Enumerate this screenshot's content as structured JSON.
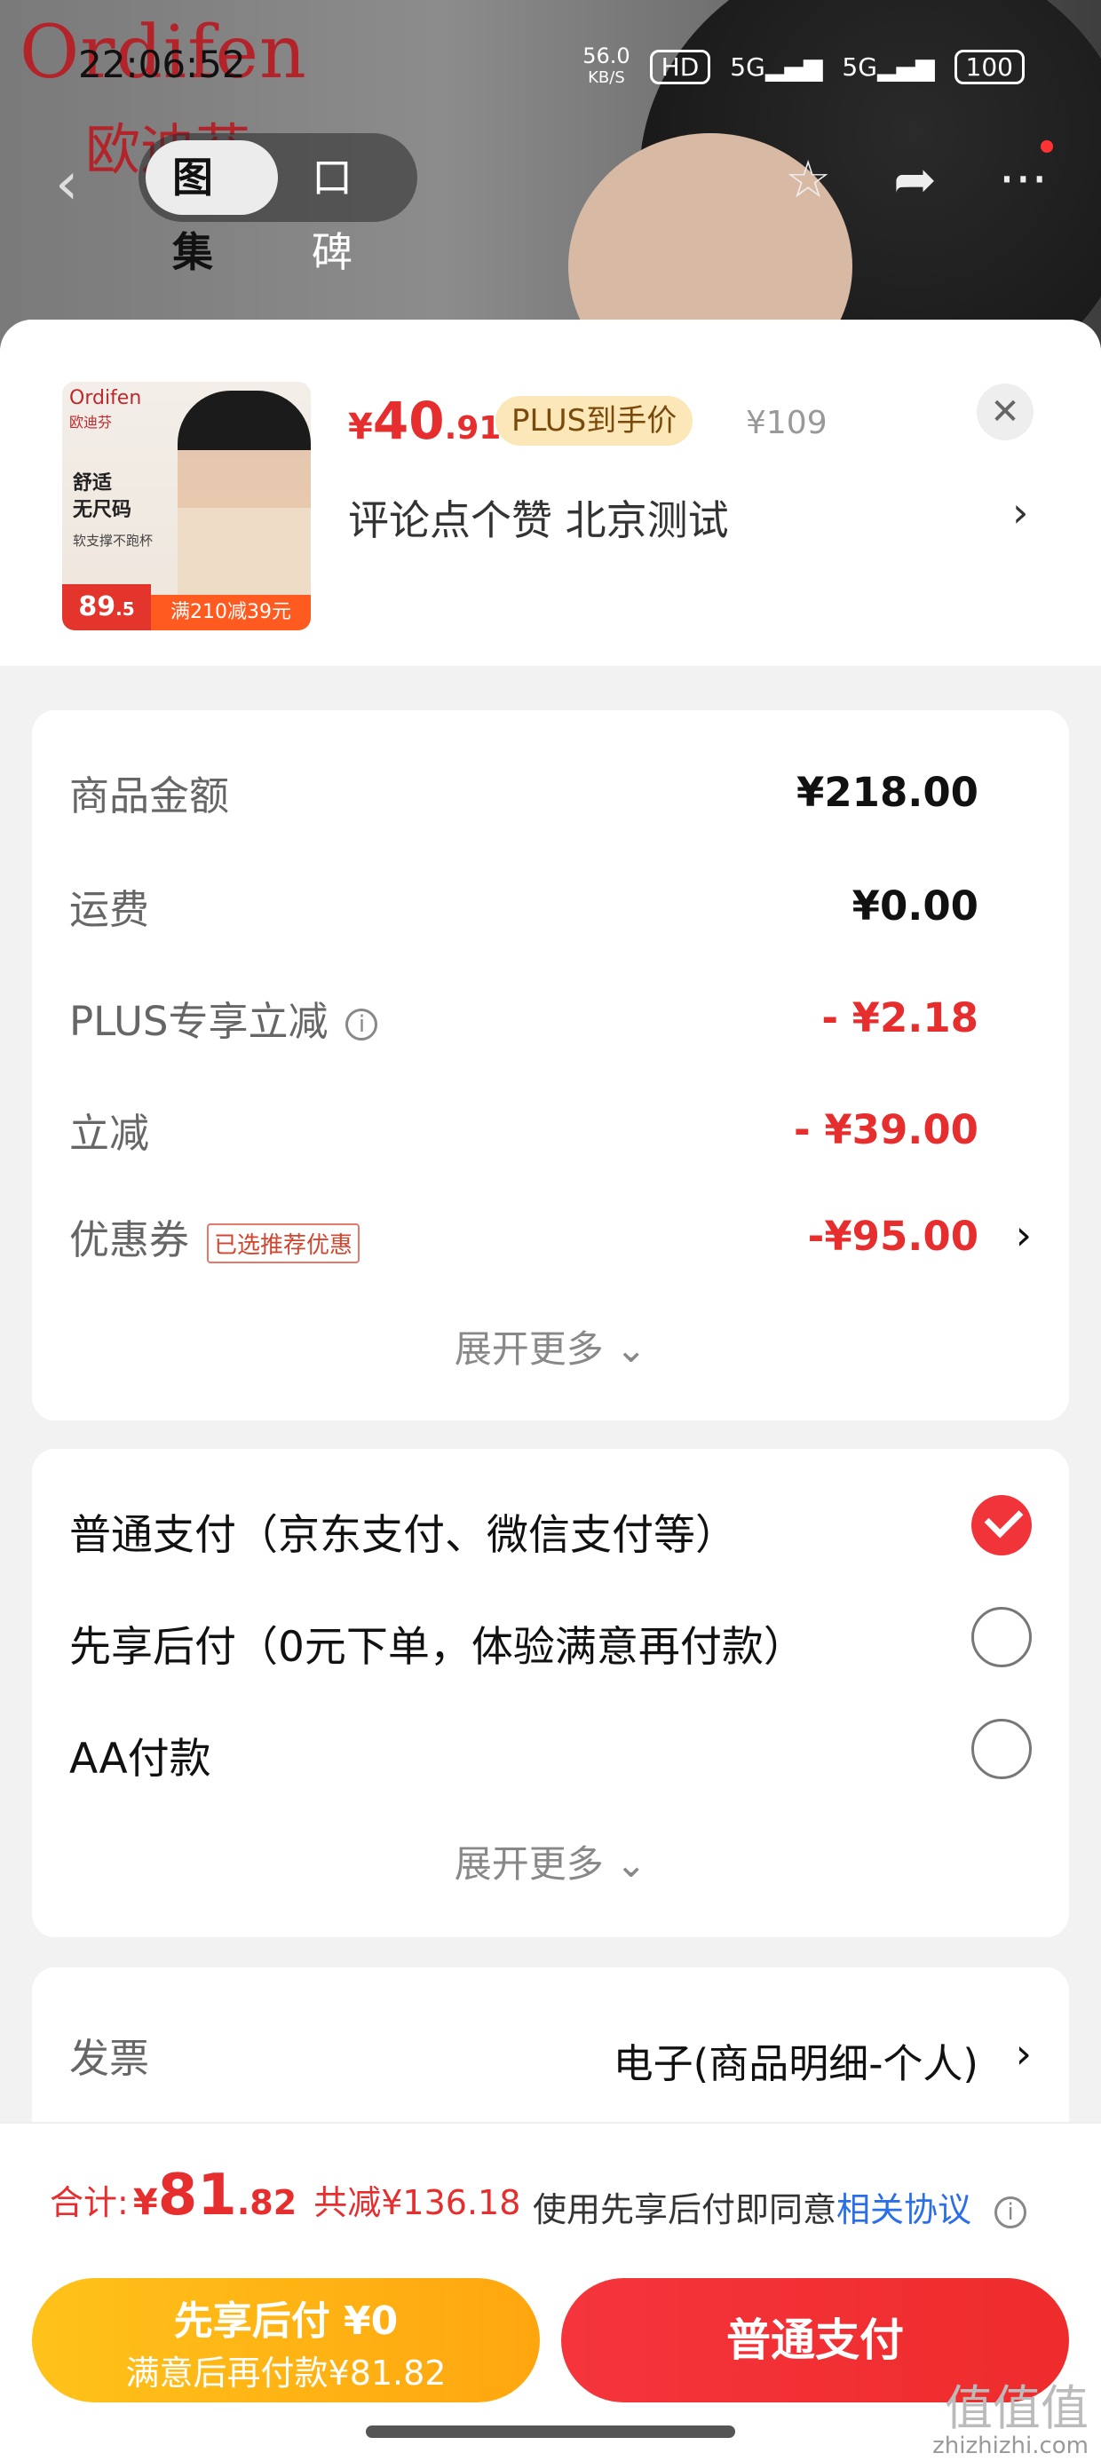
{
  "status_bar": {
    "time": "22:06:52",
    "speed": "56.0",
    "speed_unit": "KB/S",
    "hd": "HD",
    "net1": "5G",
    "net2": "5G",
    "battery": "100"
  },
  "hero": {
    "brand_en": "Ordifen",
    "brand_cn": "欧迪芬"
  },
  "nav": {
    "tabs": [
      {
        "label": "图集",
        "active": true
      },
      {
        "label": "口碑",
        "active": false
      }
    ]
  },
  "product": {
    "thumb": {
      "brand_en": "Ordifen",
      "brand_cn": "欧迪芬",
      "line1": "舒适",
      "line2": "无尺码",
      "line3": "软支撑不跑杯",
      "price": "89",
      "price_dec": ".5",
      "promo": "满210减39元"
    },
    "price_currency": "¥",
    "price_int": "40",
    "price_dec": ".91",
    "plus_badge": "PLUS到手价",
    "original_price": "¥109",
    "address": "评论点个赞  北京测试"
  },
  "amounts": {
    "rows": [
      {
        "label": "商品金额",
        "value": "¥218.00",
        "red": false
      },
      {
        "label": "运费",
        "value": "¥0.00",
        "red": false
      },
      {
        "label": "PLUS专享立减",
        "value": "- ¥2.18",
        "red": true
      },
      {
        "label": "立减",
        "value": "- ¥39.00",
        "red": true
      },
      {
        "label": "优惠券",
        "tag": "已选推荐优惠",
        "value": "-¥95.00",
        "red": true
      }
    ],
    "more": "展开更多"
  },
  "payment": {
    "options": [
      {
        "label": "普通支付（京东支付、微信支付等）",
        "selected": true
      },
      {
        "label": "先享后付（0元下单，体验满意再付款）",
        "selected": false
      },
      {
        "label": "AA付款",
        "selected": false
      }
    ],
    "more": "展开更多"
  },
  "invoice": {
    "label": "发票",
    "value": "电子(商品明细-个人)"
  },
  "summary": {
    "label": "合计:",
    "currency": "¥",
    "int": "81",
    "dec": ".82",
    "saved": "共减¥136.18",
    "agree_text": "使用先享后付即同意",
    "agree_link": "相关协议"
  },
  "buttons": {
    "later_line1": "先享后付 ¥0",
    "later_line2": "满意后再付款¥81.82",
    "pay": "普通支付"
  },
  "watermark": {
    "big": "值值值",
    "small": "zhizhizhi.com"
  },
  "colors": {
    "accent": "#e62e2e",
    "plus_badge_bg": "#fbe7b8",
    "later_button": "#ffb215",
    "pay_button": "#f1343a"
  }
}
